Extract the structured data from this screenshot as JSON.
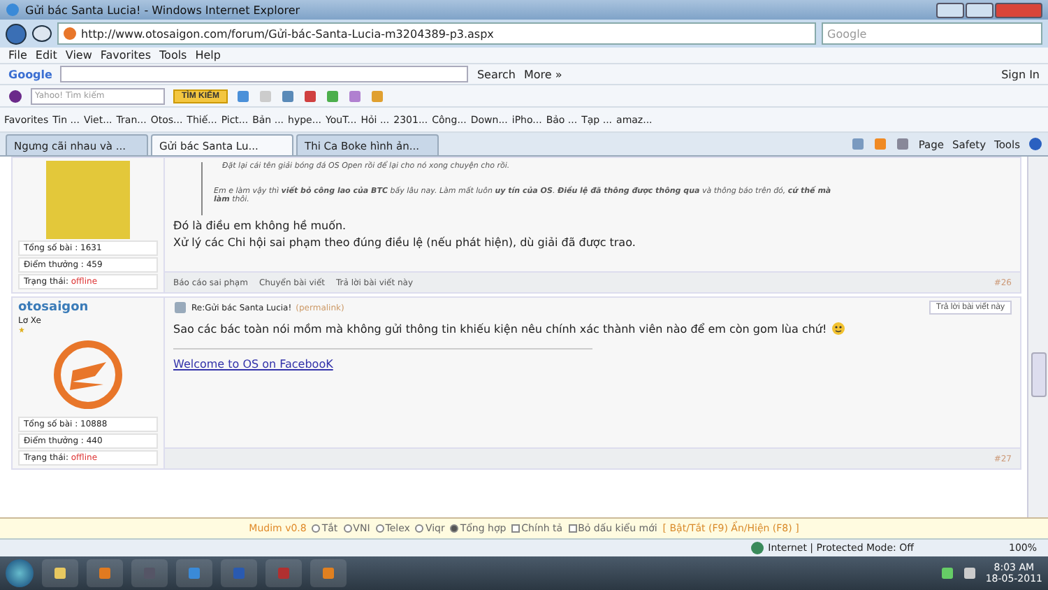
{
  "window": {
    "title": "Gửi bác Santa Lucia! - Windows Internet Explorer"
  },
  "address_bar": {
    "url": "http://www.otosaigon.com/forum/Gửi-bác-Santa-Lucia-m3204389-p3.aspx",
    "search_placeholder": "Google"
  },
  "menu": [
    "File",
    "Edit",
    "View",
    "Favorites",
    "Tools",
    "Help"
  ],
  "google_toolbar": {
    "logo": "Google",
    "search_button": "Search",
    "more": "More »",
    "sign_in": "Sign In"
  },
  "yahoo_toolbar": {
    "placeholder": "Yahoo! Tìm kiếm",
    "button": "TÌM KIẾM"
  },
  "favorites_bar": {
    "label": "Favorites",
    "items": [
      "Tin ...",
      "Viet...",
      "Tran...",
      "Otos...",
      "Thiế...",
      "Pict...",
      "Bản ...",
      "hype...",
      "YouT...",
      "Hỏi ...",
      "2301...",
      "Công...",
      "Down...",
      "iPho...",
      "Bảo ...",
      "Tạp ...",
      "amaz..."
    ]
  },
  "tabs": [
    {
      "label": "Ngưng cãi nhau và ...",
      "selected": false
    },
    {
      "label": "Gửi bác Santa Lu...",
      "selected": true
    },
    {
      "label": "Thi Ca Boke hình ản...",
      "selected": false
    }
  ],
  "command_bar": [
    "Page",
    "Safety",
    "Tools"
  ],
  "posts": [
    {
      "avatar": {
        "kind": "photo"
      },
      "stats": [
        {
          "label": "Tổng số bài : 1631"
        },
        {
          "label": "Điểm thưởng : 459"
        },
        {
          "label": "Trạng thái: ",
          "value": "offline"
        }
      ],
      "quote": [
        "Đặt lại cái tên giải bóng đá OS Open rồi để lại cho nó xong chuyện cho rồi.",
        "Em e làm vậy thì **viết bỏ công lao của BTC** bấy lâu nay. Làm mất luôn **uy tín của OS**. **Điều lệ đã thông được thông qua** và thông báo trên đó, **cứ thế mà làm** thôi."
      ],
      "body": [
        "Đó là điều em không hề muốn.",
        "Xử lý các Chi hội sai phạm theo đúng điều lệ (nếu phát hiện), dù giải đã được trao."
      ],
      "actions": [
        "Báo cáo sai phạm",
        "Chuyển bài viết",
        "Trả lời bài viết này"
      ],
      "number": "#26"
    },
    {
      "author": "otosaigon",
      "rank": "Lơ Xe",
      "avatar": {
        "kind": "logo"
      },
      "title": "Re:Gửi bác Santa Lucia!",
      "permalink": "(permalink)",
      "reply_button": "Trả lời bài viết này",
      "stats": [
        {
          "label": "Tổng số bài : 10888"
        },
        {
          "label": "Điểm thưởng : 440"
        },
        {
          "label": "Trạng thái: ",
          "value": "offline"
        }
      ],
      "body": [
        "Sao các bác toàn nói mồm mà không gửi thông tin khiếu kiện nêu chính xác thành viên nào để em còn gom lùa chứ!"
      ],
      "smiley": true,
      "signature_link": "Welcome to OS on FacebooK",
      "number": "#27"
    }
  ],
  "mudim": {
    "name": "Mudim v0.8",
    "modes": [
      {
        "label": "Tắt",
        "selected": false
      },
      {
        "label": "VNI",
        "selected": false
      },
      {
        "label": "Telex",
        "selected": false
      },
      {
        "label": "Viqr",
        "selected": false
      },
      {
        "label": "Tổng hợp",
        "selected": true
      }
    ],
    "options": [
      {
        "label": "Chính tả",
        "checked": false
      },
      {
        "label": "Bỏ dấu kiểu mới",
        "checked": false
      }
    ],
    "hotkeys": "[ Bật/Tắt (F9) Ẩn/Hiện (F8) ]"
  },
  "status_bar": {
    "zone": "Internet | Protected Mode: Off",
    "zoom": "100%"
  },
  "taskbar": {
    "time": "8:03 AM",
    "date": "18-05-2011"
  }
}
